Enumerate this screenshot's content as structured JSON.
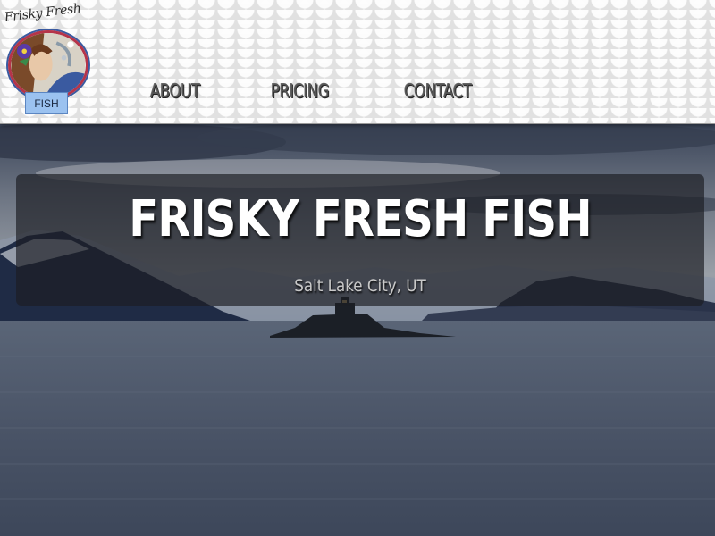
{
  "header": {
    "logo": {
      "title": "Frisky Fresh",
      "badge": "FISH"
    },
    "nav": [
      {
        "label": "ABOUT"
      },
      {
        "label": "PRICING"
      },
      {
        "label": "CONTACT"
      }
    ]
  },
  "hero": {
    "title": "FRISKY FRESH FISH",
    "subtitle": "Salt Lake City, UT"
  },
  "colors": {
    "header_bg": "#efefef",
    "nav_text": "#555555",
    "banner_bg": "#1c1e23",
    "title_text": "#ffffff",
    "subtitle_text": "#c9c9c9"
  }
}
